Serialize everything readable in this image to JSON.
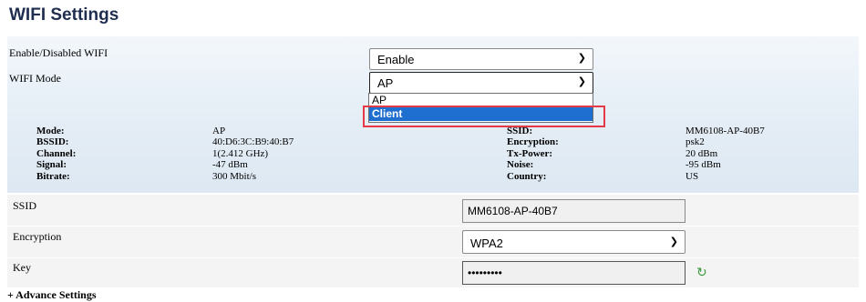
{
  "page_title": "WIFI Settings",
  "form": {
    "enable_label": "Enable/Disabled WIFI",
    "enable_value": "Enable",
    "mode_label": "WIFI Mode",
    "mode_value": "AP",
    "mode_options": [
      "AP",
      "Client"
    ],
    "mode_highlighted_option": "Client"
  },
  "status_left": {
    "labels": [
      "Mode:",
      "BSSID:",
      "Channel:",
      "Signal:",
      "Bitrate:"
    ],
    "values": [
      "AP",
      "40:D6:3C:B9:40:B7",
      "1(2.412 GHz)",
      "-47 dBm",
      "300 Mbit/s"
    ]
  },
  "status_right": {
    "labels": [
      "SSID:",
      "Encryption:",
      "Tx-Power:",
      "Noise:",
      "Country:"
    ],
    "values": [
      "MM6108-AP-40B7",
      "psk2",
      "20 dBm",
      "-95 dBm",
      "US"
    ]
  },
  "ssid": {
    "label": "SSID",
    "value": "MM6108-AP-40B7"
  },
  "encryption": {
    "label": "Encryption",
    "value": "WPA2"
  },
  "key": {
    "label": "Key",
    "value": "•••••••••"
  },
  "advance_settings": "+ Advance Settings",
  "colors": {
    "highlight": "#e63946",
    "selected_option": "#1f6fd0",
    "title": "#1f2d4f"
  },
  "icons": {
    "refresh": "refresh-icon",
    "dropdown": "chevron-down-icon"
  }
}
